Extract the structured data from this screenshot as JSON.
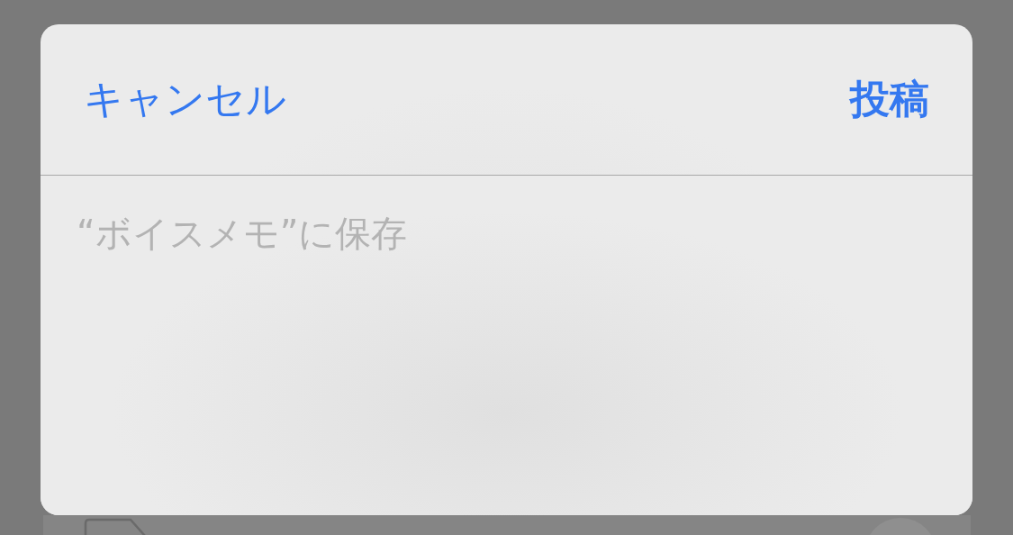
{
  "sheet": {
    "cancel": "キャンセル",
    "post": "投稿",
    "placeholder": "“ボイスメモ”に保存"
  }
}
